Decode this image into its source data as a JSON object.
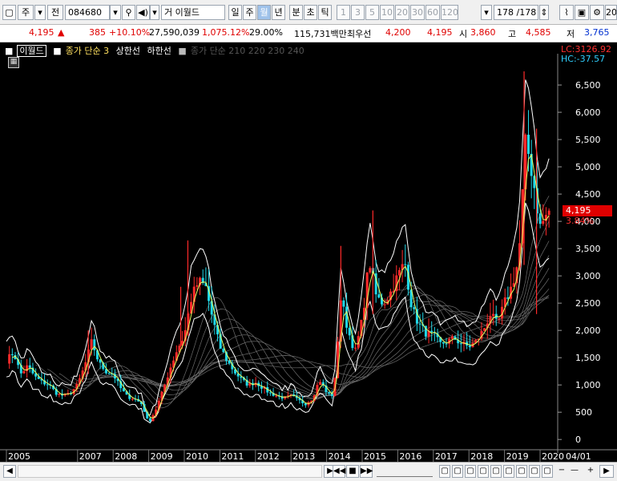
{
  "toolbar": {
    "market_button": "주",
    "jeon_button": "전",
    "code": "084680",
    "stock_name": "이월드",
    "stock_name_prefix": "거",
    "period_buttons": [
      "일",
      "주",
      "월",
      "년",
      "분",
      "초",
      "틱"
    ],
    "selected_period": "월",
    "tick_numbers": [
      "1",
      "3",
      "5",
      "10",
      "20",
      "30",
      "60",
      "120"
    ],
    "page_counter": "178 /178",
    "right_edge_text": "20"
  },
  "quote": {
    "price": "4,195",
    "up_arrow": "▲",
    "change": "385",
    "change_pct": "+10.10%",
    "volume": "27,590,039",
    "volume_ratio": "1,075.12%",
    "turnover": "29.00%",
    "amount": "115,731백만",
    "best_label": "최우선",
    "best_ask": "4,200",
    "best_bid": "4,195",
    "open_label": "시",
    "open": "3,860",
    "high_label": "고",
    "high": "4,585",
    "low_label": "저",
    "low": "3,765"
  },
  "legend": {
    "name": "이월드",
    "ma_label": "종가 단순 3",
    "upper_label": "상한선",
    "lower_label": "하한선",
    "ma_group": "종가 단순 210  220  230  240"
  },
  "price_axis": {
    "lc_label": "LC:3126.92",
    "hc_label": "HC:-37.57",
    "current_price_tag": "4,195",
    "current_pct_tag": "3.84%"
  },
  "bottom": {
    "last_label": "04/01"
  },
  "chart_data": {
    "type": "candlestick",
    "title": "",
    "y_ticks": [
      0,
      500,
      1000,
      1500,
      2000,
      2500,
      3000,
      3500,
      4000,
      4500,
      5000,
      5500,
      6000,
      6500
    ],
    "ylim": [
      -100,
      6780
    ],
    "x_tick_labels": [
      "2005",
      "2007",
      "2008",
      "2009",
      "2010",
      "2011",
      "2012",
      "2013",
      "2014",
      "2015",
      "2016",
      "2017",
      "2018",
      "2019",
      "2020"
    ],
    "x_tick_years": [
      2005,
      2007,
      2008,
      2009,
      2010,
      2011,
      2012,
      2013,
      2014,
      2015,
      2016,
      2017,
      2018,
      2019,
      2020
    ],
    "xlim": [
      2005.0,
      2020.45
    ],
    "close_trace": [
      [
        2005.0,
        1450
      ],
      [
        2005.2,
        1600
      ],
      [
        2005.4,
        1200
      ],
      [
        2005.6,
        1350
      ],
      [
        2005.8,
        1150
      ],
      [
        2006.0,
        1050
      ],
      [
        2006.2,
        1000
      ],
      [
        2006.4,
        850
      ],
      [
        2006.6,
        800
      ],
      [
        2006.8,
        850
      ],
      [
        2007.0,
        1000
      ],
      [
        2007.2,
        1350
      ],
      [
        2007.4,
        1800
      ],
      [
        2007.6,
        1400
      ],
      [
        2007.8,
        1250
      ],
      [
        2008.0,
        1200
      ],
      [
        2008.2,
        950
      ],
      [
        2008.4,
        780
      ],
      [
        2008.6,
        750
      ],
      [
        2008.8,
        650
      ],
      [
        2009.0,
        300
      ],
      [
        2009.2,
        550
      ],
      [
        2009.4,
        900
      ],
      [
        2009.6,
        1300
      ],
      [
        2009.8,
        1650
      ],
      [
        2010.0,
        1900
      ],
      [
        2010.2,
        2600
      ],
      [
        2010.4,
        2900
      ],
      [
        2010.6,
        2800
      ],
      [
        2010.8,
        2200
      ],
      [
        2011.0,
        1700
      ],
      [
        2011.2,
        1450
      ],
      [
        2011.4,
        1250
      ],
      [
        2011.6,
        1100
      ],
      [
        2011.8,
        1000
      ],
      [
        2012.0,
        1050
      ],
      [
        2012.2,
        950
      ],
      [
        2012.4,
        850
      ],
      [
        2012.6,
        800
      ],
      [
        2012.8,
        760
      ],
      [
        2013.0,
        800
      ],
      [
        2013.2,
        720
      ],
      [
        2013.4,
        650
      ],
      [
        2013.6,
        750
      ],
      [
        2013.8,
        1100
      ],
      [
        2014.0,
        850
      ],
      [
        2014.2,
        800
      ],
      [
        2014.4,
        2600
      ],
      [
        2014.6,
        2000
      ],
      [
        2014.8,
        1600
      ],
      [
        2015.0,
        2200
      ],
      [
        2015.2,
        3300
      ],
      [
        2015.4,
        2600
      ],
      [
        2015.6,
        2500
      ],
      [
        2015.8,
        2700
      ],
      [
        2016.0,
        3000
      ],
      [
        2016.2,
        3250
      ],
      [
        2016.4,
        2400
      ],
      [
        2016.6,
        2100
      ],
      [
        2016.8,
        1950
      ],
      [
        2017.0,
        1900
      ],
      [
        2017.2,
        1750
      ],
      [
        2017.4,
        1800
      ],
      [
        2017.6,
        1850
      ],
      [
        2017.8,
        1750
      ],
      [
        2018.0,
        1700
      ],
      [
        2018.2,
        1800
      ],
      [
        2018.4,
        2000
      ],
      [
        2018.6,
        2300
      ],
      [
        2018.8,
        2100
      ],
      [
        2019.0,
        2500
      ],
      [
        2019.2,
        2800
      ],
      [
        2019.4,
        3300
      ],
      [
        2019.6,
        5500
      ],
      [
        2019.8,
        4800
      ],
      [
        2020.0,
        3900
      ],
      [
        2020.25,
        4195
      ]
    ],
    "spikes": [
      {
        "x": 2007.3,
        "high": 2000,
        "low": 1200
      },
      {
        "x": 2009.9,
        "high": 2800,
        "low": 1700
      },
      {
        "x": 2010.1,
        "high": 3650,
        "low": 1900
      },
      {
        "x": 2014.4,
        "high": 3550,
        "low": 1900
      },
      {
        "x": 2015.3,
        "high": 4200,
        "low": 2300
      },
      {
        "x": 2019.55,
        "high": 6750,
        "low": 3200
      },
      {
        "x": 2019.9,
        "high": 5700,
        "low": 2300
      }
    ],
    "current_price": 4195
  }
}
